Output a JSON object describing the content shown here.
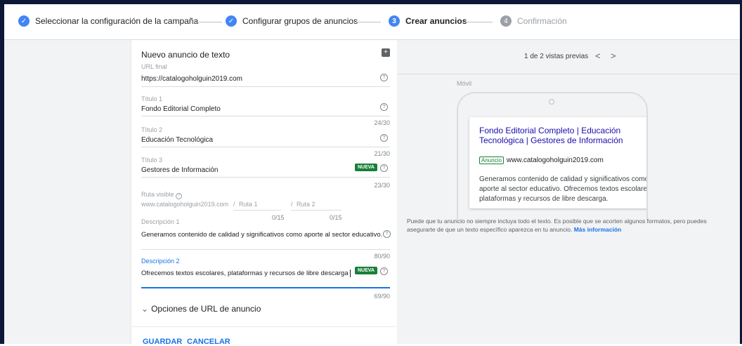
{
  "stepper": {
    "steps": [
      {
        "label": "Seleccionar la configuración de la campaña",
        "marker": "✓",
        "state": "done"
      },
      {
        "label": "Configurar grupos de anuncios",
        "marker": "✓",
        "state": "done"
      },
      {
        "label": "Crear anuncios",
        "marker": "3",
        "state": "active"
      },
      {
        "label": "Confirmación",
        "marker": "4",
        "state": "pending"
      }
    ]
  },
  "form": {
    "title": "Nuevo anuncio de texto",
    "final_url": {
      "label": "URL final",
      "value": "https://catalogoholguin2019.com"
    },
    "headline1": {
      "label": "Título 1",
      "value": "Fondo Editorial Completo",
      "count": "24/30"
    },
    "headline2": {
      "label": "Título 2",
      "value": "Educación Tecnológica",
      "count": "21/30"
    },
    "headline3": {
      "label": "Título 3",
      "value": "Gestores de Información",
      "count": "23/30",
      "badge": "NUEVA"
    },
    "display_path": {
      "label": "Ruta visible",
      "domain": "www.catalogoholguin2019.com",
      "sep1": "/",
      "path1_placeholder": "Ruta 1",
      "sep2": "/",
      "path2_placeholder": "Ruta 2",
      "count1": "0/15",
      "count2": "0/15"
    },
    "description1": {
      "label": "Descripción 1",
      "value": "Generamos contenido de calidad y significativos como aporte al sector educativo.",
      "count": "80/90"
    },
    "description2": {
      "label": "Descripción 2",
      "value": "Ofrecemos textos escolares, plataformas y recursos de libre descarga",
      "count": "69/90",
      "badge": "NUEVA"
    },
    "url_options": "Opciones de URL de anuncio",
    "save": "GUARDAR",
    "cancel": "CANCELAR"
  },
  "preview": {
    "counter": "1 de 2 vistas previas",
    "device": "Móvil",
    "ad": {
      "headline": "Fondo Editorial Completo | Educación Tecnológica | Gestores de Información",
      "badge": "Anuncio",
      "url": "www.catalogoholguin2019.com",
      "description": "Generamos contenido de calidad y significativos como aporte al sector educativo. Ofrecemos textos escolares, plataformas y recursos de libre descarga."
    },
    "note": "Puede que tu anuncio no siempre incluya todo el texto. Es posible que se acorten algunos formatos, pero puedes asegurarte de que un texto específico aparezca en tu anuncio.",
    "more_info": "Más información"
  },
  "colors": {
    "accent": "#4285f4",
    "link": "#1a73e8",
    "badge": "#188038",
    "ad_title": "#1a0dab"
  }
}
